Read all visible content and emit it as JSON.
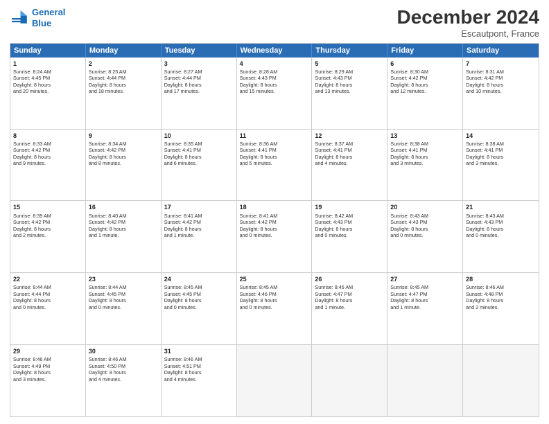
{
  "header": {
    "logo_line1": "General",
    "logo_line2": "Blue",
    "month_title": "December 2024",
    "subtitle": "Escautpont, France"
  },
  "weekdays": [
    "Sunday",
    "Monday",
    "Tuesday",
    "Wednesday",
    "Thursday",
    "Friday",
    "Saturday"
  ],
  "rows": [
    [
      {
        "day": "1",
        "lines": [
          "Sunrise: 8:24 AM",
          "Sunset: 4:45 PM",
          "Daylight: 8 hours",
          "and 20 minutes."
        ]
      },
      {
        "day": "2",
        "lines": [
          "Sunrise: 8:25 AM",
          "Sunset: 4:44 PM",
          "Daylight: 8 hours",
          "and 18 minutes."
        ]
      },
      {
        "day": "3",
        "lines": [
          "Sunrise: 8:27 AM",
          "Sunset: 4:44 PM",
          "Daylight: 8 hours",
          "and 17 minutes."
        ]
      },
      {
        "day": "4",
        "lines": [
          "Sunrise: 8:28 AM",
          "Sunset: 4:43 PM",
          "Daylight: 8 hours",
          "and 15 minutes."
        ]
      },
      {
        "day": "5",
        "lines": [
          "Sunrise: 8:29 AM",
          "Sunset: 4:43 PM",
          "Daylight: 8 hours",
          "and 13 minutes."
        ]
      },
      {
        "day": "6",
        "lines": [
          "Sunrise: 8:30 AM",
          "Sunset: 4:42 PM",
          "Daylight: 8 hours",
          "and 12 minutes."
        ]
      },
      {
        "day": "7",
        "lines": [
          "Sunrise: 8:31 AM",
          "Sunset: 4:42 PM",
          "Daylight: 8 hours",
          "and 10 minutes."
        ]
      }
    ],
    [
      {
        "day": "8",
        "lines": [
          "Sunrise: 8:33 AM",
          "Sunset: 4:42 PM",
          "Daylight: 8 hours",
          "and 9 minutes."
        ]
      },
      {
        "day": "9",
        "lines": [
          "Sunrise: 8:34 AM",
          "Sunset: 4:42 PM",
          "Daylight: 8 hours",
          "and 8 minutes."
        ]
      },
      {
        "day": "10",
        "lines": [
          "Sunrise: 8:35 AM",
          "Sunset: 4:41 PM",
          "Daylight: 8 hours",
          "and 6 minutes."
        ]
      },
      {
        "day": "11",
        "lines": [
          "Sunrise: 8:36 AM",
          "Sunset: 4:41 PM",
          "Daylight: 8 hours",
          "and 5 minutes."
        ]
      },
      {
        "day": "12",
        "lines": [
          "Sunrise: 8:37 AM",
          "Sunset: 4:41 PM",
          "Daylight: 8 hours",
          "and 4 minutes."
        ]
      },
      {
        "day": "13",
        "lines": [
          "Sunrise: 8:38 AM",
          "Sunset: 4:41 PM",
          "Daylight: 8 hours",
          "and 3 minutes."
        ]
      },
      {
        "day": "14",
        "lines": [
          "Sunrise: 8:38 AM",
          "Sunset: 4:41 PM",
          "Daylight: 8 hours",
          "and 3 minutes."
        ]
      }
    ],
    [
      {
        "day": "15",
        "lines": [
          "Sunrise: 8:39 AM",
          "Sunset: 4:42 PM",
          "Daylight: 8 hours",
          "and 2 minutes."
        ]
      },
      {
        "day": "16",
        "lines": [
          "Sunrise: 8:40 AM",
          "Sunset: 4:42 PM",
          "Daylight: 8 hours",
          "and 1 minute."
        ]
      },
      {
        "day": "17",
        "lines": [
          "Sunrise: 8:41 AM",
          "Sunset: 4:42 PM",
          "Daylight: 8 hours",
          "and 1 minute."
        ]
      },
      {
        "day": "18",
        "lines": [
          "Sunrise: 8:41 AM",
          "Sunset: 4:42 PM",
          "Daylight: 8 hours",
          "and 0 minutes."
        ]
      },
      {
        "day": "19",
        "lines": [
          "Sunrise: 8:42 AM",
          "Sunset: 4:43 PM",
          "Daylight: 8 hours",
          "and 0 minutes."
        ]
      },
      {
        "day": "20",
        "lines": [
          "Sunrise: 8:43 AM",
          "Sunset: 4:43 PM",
          "Daylight: 8 hours",
          "and 0 minutes."
        ]
      },
      {
        "day": "21",
        "lines": [
          "Sunrise: 8:43 AM",
          "Sunset: 4:43 PM",
          "Daylight: 8 hours",
          "and 0 minutes."
        ]
      }
    ],
    [
      {
        "day": "22",
        "lines": [
          "Sunrise: 8:44 AM",
          "Sunset: 4:44 PM",
          "Daylight: 8 hours",
          "and 0 minutes."
        ]
      },
      {
        "day": "23",
        "lines": [
          "Sunrise: 8:44 AM",
          "Sunset: 4:45 PM",
          "Daylight: 8 hours",
          "and 0 minutes."
        ]
      },
      {
        "day": "24",
        "lines": [
          "Sunrise: 8:45 AM",
          "Sunset: 4:45 PM",
          "Daylight: 8 hours",
          "and 0 minutes."
        ]
      },
      {
        "day": "25",
        "lines": [
          "Sunrise: 8:45 AM",
          "Sunset: 4:46 PM",
          "Daylight: 8 hours",
          "and 0 minutes."
        ]
      },
      {
        "day": "26",
        "lines": [
          "Sunrise: 8:45 AM",
          "Sunset: 4:47 PM",
          "Daylight: 8 hours",
          "and 1 minute."
        ]
      },
      {
        "day": "27",
        "lines": [
          "Sunrise: 8:45 AM",
          "Sunset: 4:47 PM",
          "Daylight: 8 hours",
          "and 1 minute."
        ]
      },
      {
        "day": "28",
        "lines": [
          "Sunrise: 8:46 AM",
          "Sunset: 4:48 PM",
          "Daylight: 8 hours",
          "and 2 minutes."
        ]
      }
    ],
    [
      {
        "day": "29",
        "lines": [
          "Sunrise: 8:46 AM",
          "Sunset: 4:49 PM",
          "Daylight: 8 hours",
          "and 3 minutes."
        ]
      },
      {
        "day": "30",
        "lines": [
          "Sunrise: 8:46 AM",
          "Sunset: 4:50 PM",
          "Daylight: 8 hours",
          "and 4 minutes."
        ]
      },
      {
        "day": "31",
        "lines": [
          "Sunrise: 8:46 AM",
          "Sunset: 4:51 PM",
          "Daylight: 8 hours",
          "and 4 minutes."
        ]
      },
      null,
      null,
      null,
      null
    ]
  ]
}
